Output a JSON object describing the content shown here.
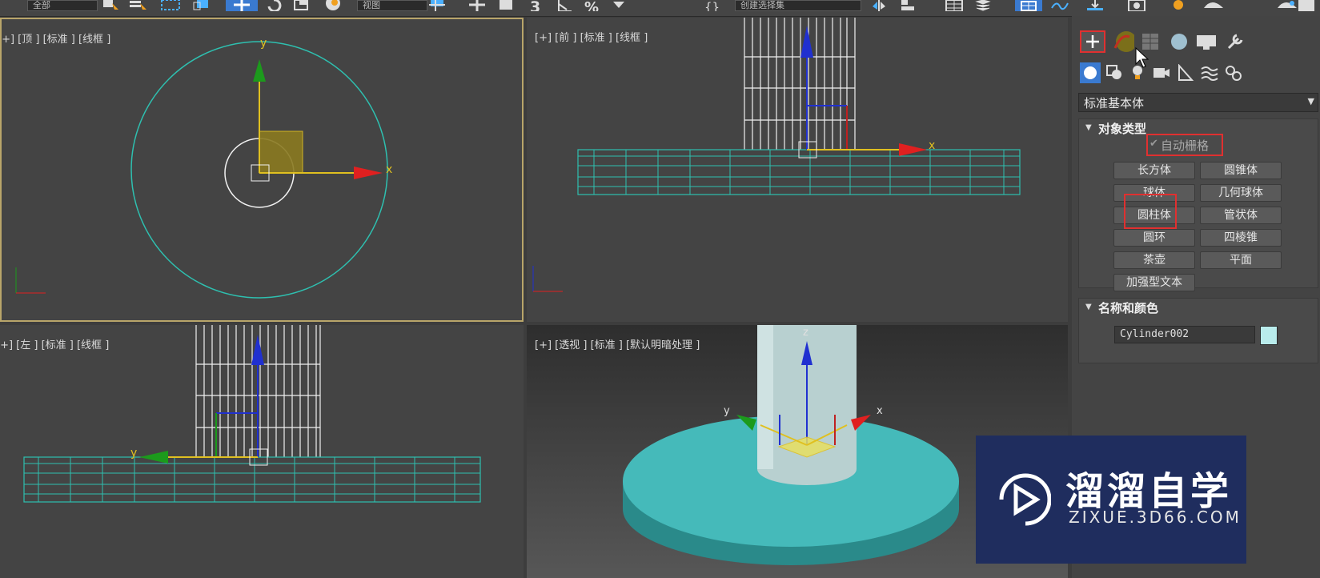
{
  "toolbar": {
    "selection_filter": "全部",
    "ref_coord": "视图",
    "named_selection": "创建选择集"
  },
  "viewports": {
    "top": {
      "label": "[+] [顶 ] [标准 ] [线框 ]"
    },
    "front": {
      "label": "[+] [前 ] [标准 ] [线框 ]"
    },
    "left": {
      "label": "[+] [左 ] [标准 ] [线框 ]"
    },
    "perspective": {
      "label": "[+] [透视 ] [标准 ] [默认明暗处理 ]"
    }
  },
  "axis_labels": {
    "x": "x",
    "y": "y",
    "z": "z"
  },
  "command_panel": {
    "tabs": [
      "create-icon",
      "modify-icon",
      "hierarchy-icon",
      "motion-icon",
      "display-icon",
      "utilities-icon"
    ],
    "subtabs": [
      "geometry-icon",
      "shapes-icon",
      "lights-icon",
      "cameras-icon",
      "helpers-icon",
      "spacewarps-icon",
      "systems-icon"
    ],
    "category": "标准基本体",
    "object_type": {
      "title": "对象类型",
      "autogrid": "自动栅格",
      "buttons": [
        "长方体",
        "圆锥体",
        "球体",
        "几何球体",
        "圆柱体",
        "管状体",
        "圆环",
        "四棱锥",
        "茶壶",
        "平面",
        "加强型文本"
      ]
    },
    "name_color": {
      "title": "名称和颜色",
      "name": "Cylinder002",
      "color": "#b9ecec"
    }
  },
  "watermark": {
    "brand": "溜溜自学",
    "url": "ZIXUE.3D66.COM"
  }
}
